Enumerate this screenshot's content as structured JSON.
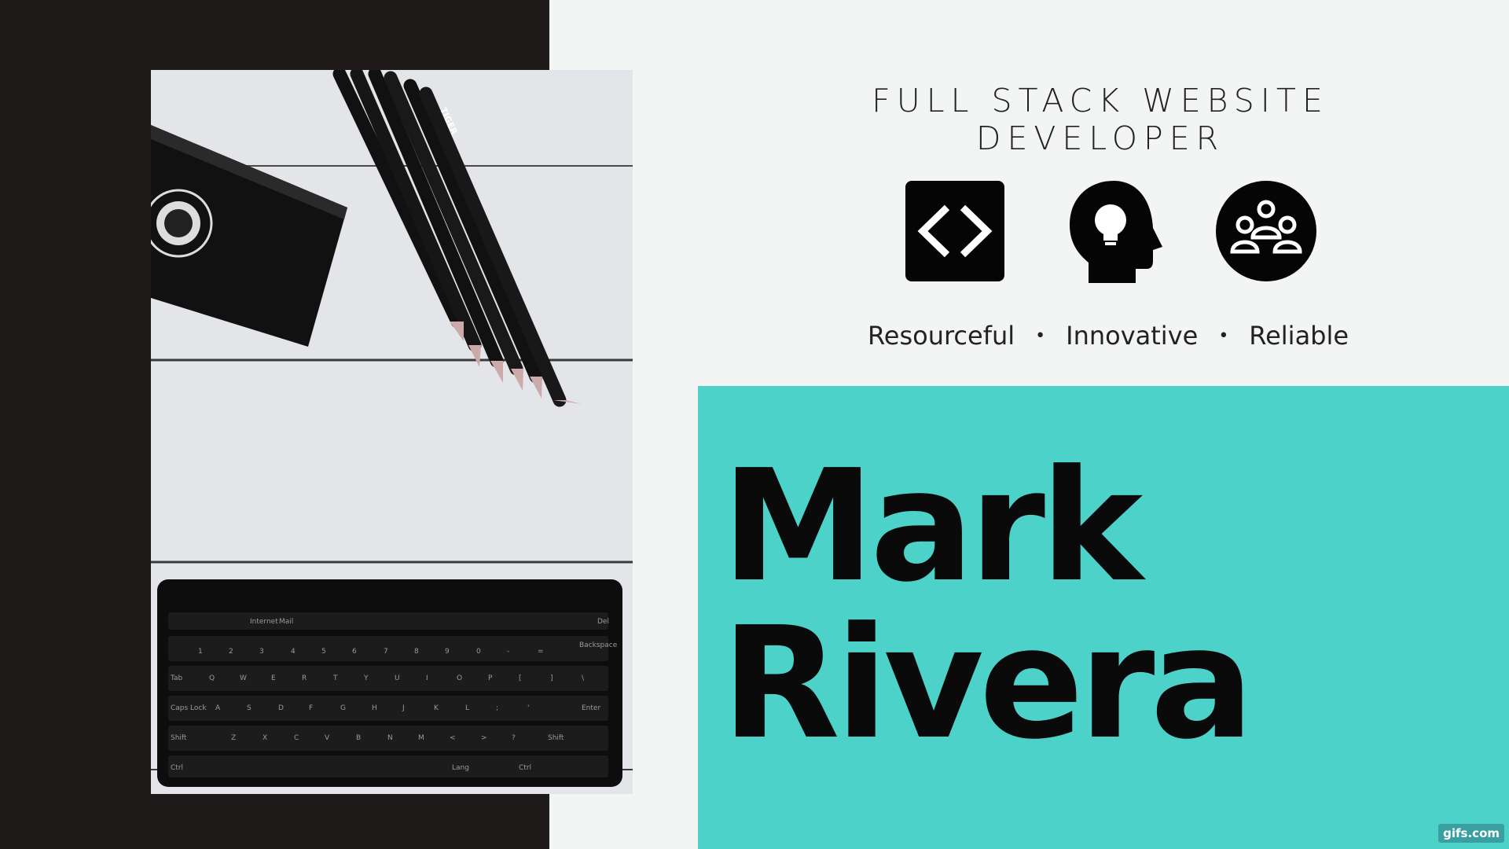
{
  "header": {
    "title": "FULL STACK WEBSITE DEVELOPER"
  },
  "icons": [
    {
      "name": "code-brackets-icon"
    },
    {
      "name": "head-lightbulb-icon"
    },
    {
      "name": "team-group-icon"
    }
  ],
  "traits": [
    "Resourceful",
    "Innovative",
    "Reliable"
  ],
  "trait_separator": "•",
  "name": {
    "first": "Mark",
    "last": "Rivera"
  },
  "colors": {
    "dark": "#1f1b1a",
    "background": "#f3f5f4",
    "accent": "#4dd2ca",
    "text": "#0a0a0a"
  },
  "keyboard": {
    "fn_row": [
      "Internet",
      "Mail",
      "Del"
    ],
    "row1": [
      "1",
      "2",
      "3",
      "4",
      "5",
      "6",
      "7",
      "8",
      "9",
      "0",
      "-",
      "=",
      "Backspace"
    ],
    "row2": [
      "Tab",
      "Q",
      "W",
      "E",
      "R",
      "T",
      "Y",
      "U",
      "I",
      "O",
      "P",
      "[",
      "]",
      "\\"
    ],
    "row3": [
      "Caps Lock",
      "A",
      "S",
      "D",
      "F",
      "G",
      "H",
      "J",
      "K",
      "L",
      ";",
      "'",
      "Enter"
    ],
    "row4": [
      "Shift",
      "Z",
      "X",
      "C",
      "V",
      "B",
      "N",
      "M",
      "<",
      ">",
      "?",
      "Shift"
    ],
    "row5": [
      "Ctrl",
      "Lang",
      "Ctrl"
    ]
  },
  "pencil_brand": "TIGER",
  "watermark": "gifs.com"
}
